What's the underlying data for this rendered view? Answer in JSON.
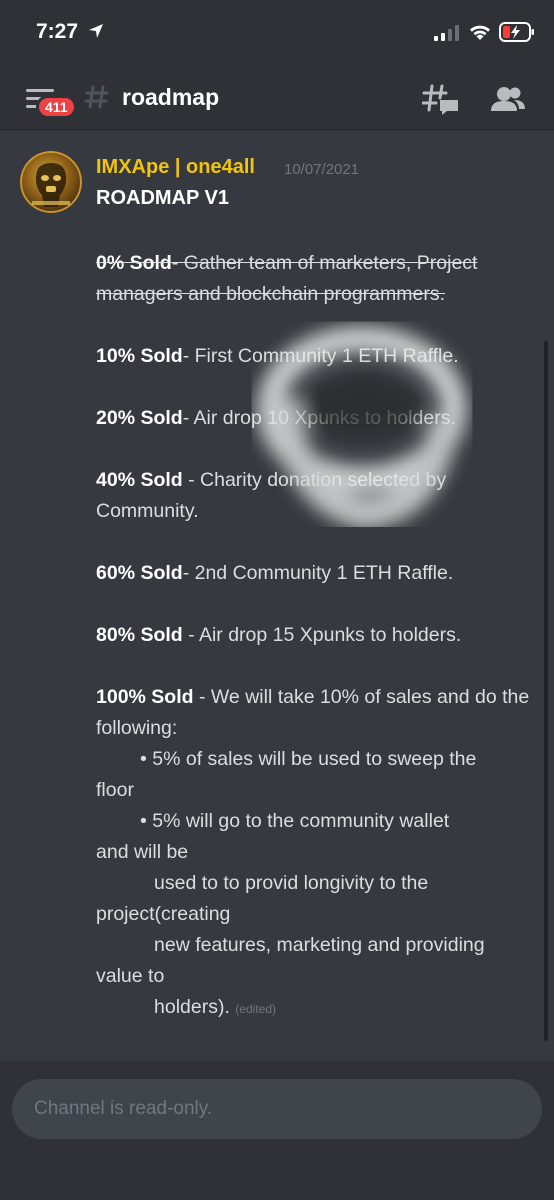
{
  "status_bar": {
    "time": "7:27",
    "icons": [
      "location-arrow-icon",
      "cellular-signal-icon",
      "wifi-icon",
      "battery-charging-icon"
    ],
    "battery_color": "#ff3b30"
  },
  "header": {
    "unread_count": "411",
    "channel_name": "roadmap",
    "icons": [
      "menu-icon",
      "hash-icon",
      "threads-icon",
      "members-icon"
    ]
  },
  "message": {
    "author": "IMXApe | one4all",
    "author_color": "#f1c40f",
    "timestamp": "10/07/2021",
    "title": "ROADMAP V1",
    "items": {
      "s0_bold": "0% Sold",
      "s0_text": "- Gather team of marketers, Project managers and blockchain programmers.",
      "s10_bold": "10% Sold",
      "s10_text": "- First Community 1 ETH Raffle.",
      "s20_bold": "20% Sold",
      "s20_text": "- Air drop 10 Xpunks to holders.",
      "s40_bold": "40% Sold",
      "s40_text": " - Charity donation selected by Community.",
      "s60_bold": "60% Sold",
      "s60_text": "- 2nd Community 1 ETH Raffle.",
      "s80_bold": "80% Sold",
      "s80_text": " - Air drop 15 Xpunks to holders.",
      "s100_bold": "100% Sold",
      "s100_text": " - We will take 10% of sales and do the following:",
      "bullet1_a": "• 5% of sales will be used to sweep the",
      "bullet1_b": "floor",
      "bullet2_a": "• 5% will go to the community wallet",
      "bullet2_b": "and will be",
      "line3_a": "used to to provid longivity to the",
      "line3_b": "project(creating",
      "line4_a": "new features, marketing and providing",
      "line4_b": "value to",
      "line5": "holders).",
      "edited": "(edited)"
    }
  },
  "composer": {
    "placeholder": "Channel is read-only."
  },
  "colors": {
    "background": "#36393f",
    "header": "#2f3136",
    "badge": "#ed4245",
    "input": "#40444b"
  }
}
